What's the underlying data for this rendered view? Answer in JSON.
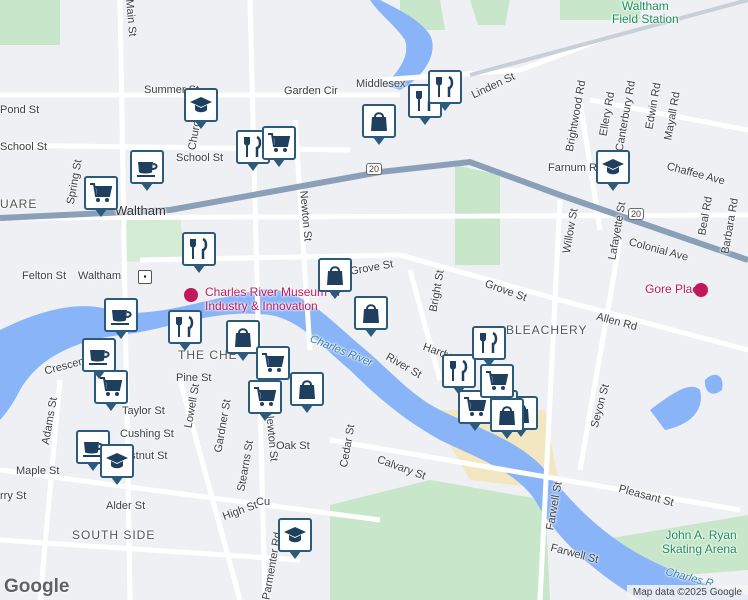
{
  "map": {
    "attribution": "Map data ©2025 Google",
    "logo": "Google",
    "labels": {
      "waltham_field_station": "Waltham\nField Station",
      "waltham": "Waltham",
      "waltham_station": "Waltham",
      "south_side": "SOUTH SIDE",
      "bleachery": "BLEACHERY",
      "the_chemistry": "THE CHE",
      "square": "UARE",
      "charles_river_1": "Charles River",
      "charles_river_2": "Charles R",
      "museum": "Charles River Museum of\nIndustry & Innovation",
      "gore_place": "Gore Place",
      "john_a_ryan": "John A. Ryan\nSkating Arena",
      "streets": {
        "main_st": "Main St",
        "moody_st": "Moody St",
        "summer_st": "Summer St",
        "pond_st": "Pond St",
        "school_st_1": "School St",
        "school_st_2": "School St",
        "spring_st": "Spring St",
        "church_st": "Church St",
        "garden_cir": "Garden Cir",
        "middlesex": "Middlesex",
        "linden_st": "Linden St",
        "newton_st_1": "Newton St",
        "newton_st_2": "Newton St",
        "grove_st_1": "Grove St",
        "grove_st_2": "Grove St",
        "bright_st": "Bright St",
        "felton_st": "Felton St",
        "crescent": "Crescent",
        "pine_st": "Pine St",
        "adams_st": "Adams St",
        "taylor_st": "Taylor St",
        "cushing_st": "Cushing St",
        "chestnut_st": "Chestnut St",
        "lowell_st": "Lowell St",
        "gardner_st": "Gardner St",
        "stearns_st": "Stearns St",
        "oak_st": "Oak St",
        "maple_st": "Maple St",
        "alder_st": "Alder St",
        "high_st": "High St",
        "cedar_st": "Cedar St",
        "calvary_st": "Calvary St",
        "river_st": "River St",
        "hardy_st": "Hardy St",
        "curtis_st": "Cu",
        "parmenter_rd": "Parmenter Rd",
        "felton_st2": "",
        "brightwood_rd": "Brightwood Rd",
        "ellery_rd": "Ellery Rd",
        "canterbury_rd": "Canterbury Rd",
        "edwin_rd": "Edwin Rd",
        "mayall_rd": "Mayall Rd",
        "farnum_rd": "Farnum Rd",
        "chaffee_ave": "Chaffee Ave",
        "willow_st": "Willow St",
        "lafayette_st": "Lafayette St",
        "beal_rd": "Beal Rd",
        "barbara_rd": "Barbara Rd",
        "colonial_ave": "Colonial Ave",
        "allen_rd": "Allen Rd",
        "seyon_st": "Seyon St",
        "pleasant_st": "Pleasant St",
        "farwell_st_1": "Farwell St",
        "farwell_st_2": "Farwell St",
        "route_20_a": "20",
        "route_20_b": "20",
        "crosby_st": "rry St",
        "pine_st2": "Pine St"
      }
    },
    "markers": [
      {
        "type": "school",
        "icon": "graduation-cap-icon"
      },
      {
        "type": "shopping",
        "icon": "shopping-bag-icon"
      },
      {
        "type": "restaurant",
        "icon": "fork-knife-icon"
      },
      {
        "type": "restaurant",
        "icon": "fork-knife-icon"
      },
      {
        "type": "cafe",
        "icon": "coffee-cup-icon"
      },
      {
        "type": "grocery",
        "icon": "shopping-cart-icon"
      },
      {
        "type": "restaurant",
        "icon": "fork-knife-icon"
      },
      {
        "type": "grocery",
        "icon": "shopping-cart-icon"
      },
      {
        "type": "school",
        "icon": "graduation-cap-icon"
      },
      {
        "type": "shopping",
        "icon": "shopping-bag-icon"
      },
      {
        "type": "restaurant",
        "icon": "fork-knife-icon"
      },
      {
        "type": "shopping",
        "icon": "shopping-bag-icon"
      },
      {
        "type": "shopping",
        "icon": "shopping-bag-icon"
      },
      {
        "type": "cafe",
        "icon": "coffee-cup-icon"
      },
      {
        "type": "restaurant",
        "icon": "fork-knife-icon"
      },
      {
        "type": "shopping",
        "icon": "shopping-bag-icon"
      },
      {
        "type": "grocery",
        "icon": "shopping-cart-icon"
      },
      {
        "type": "grocery",
        "icon": "shopping-cart-icon"
      },
      {
        "type": "shopping",
        "icon": "shopping-bag-icon"
      },
      {
        "type": "grocery",
        "icon": "shopping-cart-icon"
      },
      {
        "type": "cafe",
        "icon": "coffee-cup-icon"
      },
      {
        "type": "cafe",
        "icon": "coffee-cup-icon"
      },
      {
        "type": "school",
        "icon": "graduation-cap-icon"
      },
      {
        "type": "grocery",
        "icon": "shopping-cart-icon"
      },
      {
        "type": "school",
        "icon": "graduation-cap-icon"
      },
      {
        "type": "restaurant",
        "icon": "fork-knife-icon"
      },
      {
        "type": "restaurant",
        "icon": "fork-knife-icon"
      },
      {
        "type": "grocery",
        "icon": "shopping-cart-icon"
      },
      {
        "type": "grocery",
        "icon": "shopping-cart-icon"
      },
      {
        "type": "shopping",
        "icon": "shopping-bag-icon"
      }
    ],
    "colors": {
      "background": "#eef0f3",
      "water": "#8ab4f8",
      "park": "#c8e6c9",
      "highway": "#8aa0b8",
      "marker_border": "#2b5a7c",
      "marker_icon": "#1f3f5f"
    }
  }
}
